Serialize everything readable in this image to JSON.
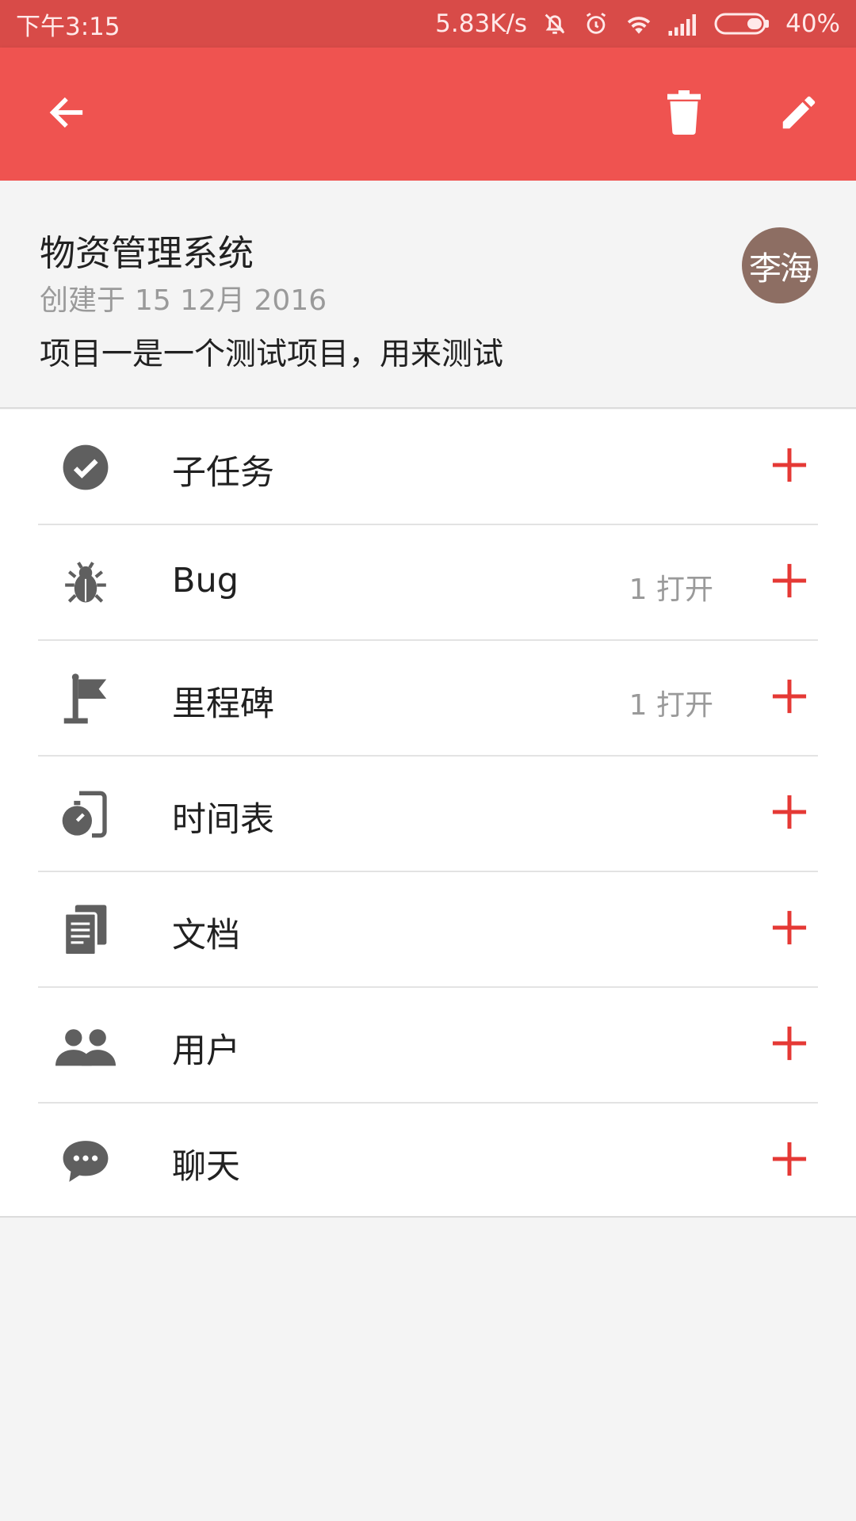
{
  "status_bar": {
    "time": "下午3:15",
    "net_speed": "5.83K/s",
    "battery": "40%",
    "icons": [
      "bell-off-icon",
      "alarm-icon",
      "wifi-icon",
      "signal-icon",
      "battery-icon"
    ]
  },
  "app_bar": {
    "icons": [
      "back-arrow-icon",
      "trash-icon",
      "edit-pencil-icon"
    ],
    "color": "#ef5350"
  },
  "project": {
    "title": "物资管理系统",
    "created_prefix": "创建于",
    "created_date": "15 12月 2016",
    "description": "项目一是一个测试项目，用来测试",
    "owner_avatar_text": "李海",
    "avatar_color": "#8d6e63"
  },
  "sections": [
    {
      "label": "子任务",
      "count": "",
      "icon": "check-circle-icon"
    },
    {
      "label": "Bug",
      "count": "1 打开",
      "icon": "bug-icon"
    },
    {
      "label": "里程碑",
      "count": "1 打开",
      "icon": "flag-icon"
    },
    {
      "label": "时间表",
      "count": "",
      "icon": "stopwatch-icon"
    },
    {
      "label": "文档",
      "count": "",
      "icon": "documents-icon"
    },
    {
      "label": "用户",
      "count": "",
      "icon": "users-icon"
    },
    {
      "label": "聊天",
      "count": "",
      "icon": "chat-bubble-icon"
    }
  ],
  "add_icon": "plus-icon",
  "accent_color": "#e53935"
}
